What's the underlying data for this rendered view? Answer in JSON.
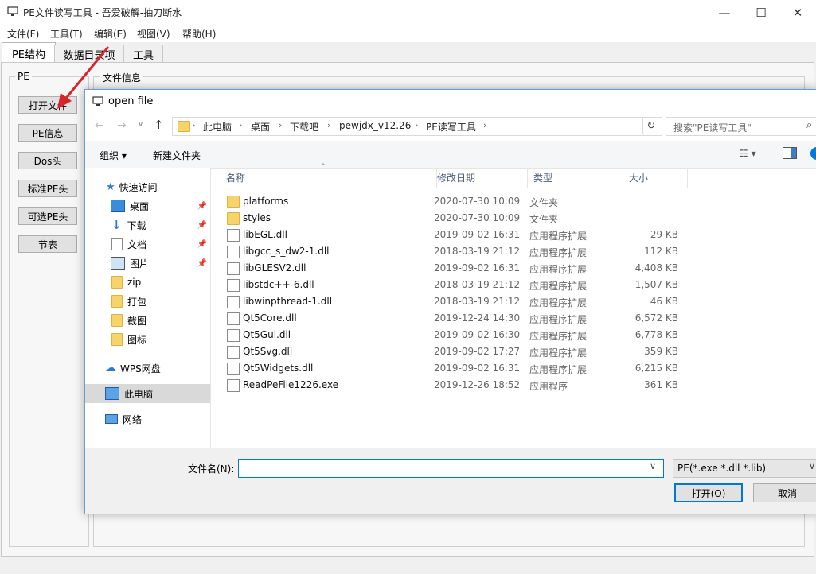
{
  "app": {
    "title": "PE文件读写工具 - 吾爱破解-抽刀断水",
    "window_controls": {
      "minimize": "—",
      "maximize": "☐",
      "close": "✕"
    },
    "menu": [
      "文件(F)",
      "工具(T)",
      "编辑(E)",
      "视图(V)",
      "帮助(H)"
    ],
    "tabs": [
      "PE结构",
      "数据目录项",
      "工具"
    ],
    "left_group_label": "PE",
    "right_group_label": "文件信息",
    "left_buttons": [
      "打开文件",
      "PE信息",
      "Dos头",
      "标准PE头",
      "可选PE头",
      "节表"
    ]
  },
  "dialog": {
    "title": "open file",
    "breadcrumb": [
      "此电脑",
      "桌面",
      "下载吧",
      "pewjdx_v12.26",
      "PE读写工具"
    ],
    "search_placeholder": "搜索\"PE读写工具\"",
    "toolbar": {
      "organize": "组织 ▾",
      "new_folder": "新建文件夹"
    },
    "nav": {
      "quick_access": "快速访问",
      "items": [
        {
          "label": "桌面",
          "icon": "desktop-icon",
          "pinned": true
        },
        {
          "label": "下载",
          "icon": "download-icon",
          "pinned": true
        },
        {
          "label": "文档",
          "icon": "document-icon",
          "pinned": true
        },
        {
          "label": "图片",
          "icon": "picture-icon",
          "pinned": true
        },
        {
          "label": "zip",
          "icon": "folder-icon",
          "pinned": false
        },
        {
          "label": "打包",
          "icon": "folder-icon",
          "pinned": false
        },
        {
          "label": "截图",
          "icon": "folder-icon",
          "pinned": false
        },
        {
          "label": "图标",
          "icon": "folder-icon",
          "pinned": false
        }
      ],
      "wps": "WPS网盘",
      "this_pc": "此电脑",
      "network": "网络"
    },
    "columns": {
      "name": "名称",
      "date": "修改日期",
      "type": "类型",
      "size": "大小"
    },
    "files": [
      {
        "name": "platforms",
        "date": "2020-07-30 10:09",
        "type": "文件夹",
        "size": "",
        "kind": "folder"
      },
      {
        "name": "styles",
        "date": "2020-07-30 10:09",
        "type": "文件夹",
        "size": "",
        "kind": "folder"
      },
      {
        "name": "libEGL.dll",
        "date": "2019-09-02 16:31",
        "type": "应用程序扩展",
        "size": "29 KB",
        "kind": "dll"
      },
      {
        "name": "libgcc_s_dw2-1.dll",
        "date": "2018-03-19 21:12",
        "type": "应用程序扩展",
        "size": "112 KB",
        "kind": "dll"
      },
      {
        "name": "libGLESV2.dll",
        "date": "2019-09-02 16:31",
        "type": "应用程序扩展",
        "size": "4,408 KB",
        "kind": "dll"
      },
      {
        "name": "libstdc++-6.dll",
        "date": "2018-03-19 21:12",
        "type": "应用程序扩展",
        "size": "1,507 KB",
        "kind": "dll"
      },
      {
        "name": "libwinpthread-1.dll",
        "date": "2018-03-19 21:12",
        "type": "应用程序扩展",
        "size": "46 KB",
        "kind": "dll"
      },
      {
        "name": "Qt5Core.dll",
        "date": "2019-12-24 14:30",
        "type": "应用程序扩展",
        "size": "6,572 KB",
        "kind": "dll"
      },
      {
        "name": "Qt5Gui.dll",
        "date": "2019-09-02 16:30",
        "type": "应用程序扩展",
        "size": "6,778 KB",
        "kind": "dll"
      },
      {
        "name": "Qt5Svg.dll",
        "date": "2019-09-02 17:27",
        "type": "应用程序扩展",
        "size": "359 KB",
        "kind": "dll"
      },
      {
        "name": "Qt5Widgets.dll",
        "date": "2019-09-02 16:31",
        "type": "应用程序扩展",
        "size": "6,215 KB",
        "kind": "dll"
      },
      {
        "name": "ReadPeFile1226.exe",
        "date": "2019-12-26 18:52",
        "type": "应用程序",
        "size": "361 KB",
        "kind": "exe"
      }
    ],
    "filename_label": "文件名(N):",
    "filename_value": "",
    "filter": "PE(*.exe *.dll *.lib)",
    "open": "打开(O)",
    "cancel": "取消"
  },
  "colors": {
    "accent": "#0078d7",
    "arrow": "#d7262a",
    "selection": "#d9d9d9"
  }
}
